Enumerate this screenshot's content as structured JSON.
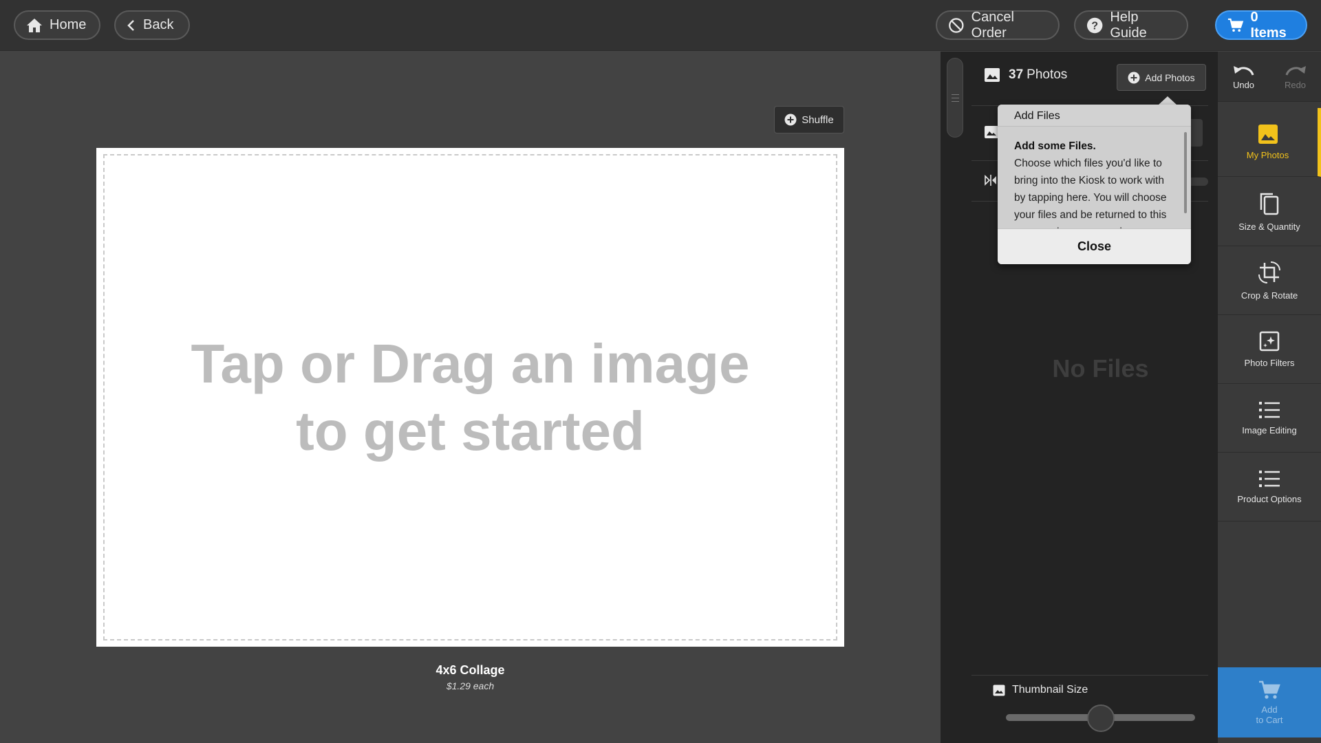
{
  "topbar": {
    "home_label": "Home",
    "back_label": "Back",
    "cancel_label": "Cancel Order",
    "help_label": "Help Guide",
    "cart_label": "0 Items"
  },
  "canvas": {
    "shuffle_label": "Shuffle",
    "drop_line1": "Tap or Drag an image",
    "drop_line2": "to get started",
    "product_name": "4x6 Collage",
    "product_price": "$1.29 each"
  },
  "photos_panel": {
    "count": "37",
    "count_label": "Photos",
    "add_photos_label": "Add Photos",
    "empty_label": "No Files",
    "thumbnail_label": "Thumbnail Size",
    "thumbnail_size_fraction": 0.5
  },
  "popover": {
    "title": "Add Files",
    "lead": "Add some Files.",
    "body": "Choose which files you'd like to bring into the Kiosk to work with by tapping here. You will choose your files and be returned to this screen when you are done.",
    "close_label": "Close"
  },
  "rail": {
    "undo_label": "Undo",
    "redo_label": "Redo",
    "tools": [
      {
        "label": "My Photos",
        "icon": "image-icon",
        "active": true
      },
      {
        "label": "Size & Quantity",
        "icon": "copy-icon",
        "active": false
      },
      {
        "label": "Crop & Rotate",
        "icon": "crop-rotate-icon",
        "active": false
      },
      {
        "label": "Photo Filters",
        "icon": "filter-icon",
        "active": false
      },
      {
        "label": "Image Editing",
        "icon": "sliders-icon",
        "active": false
      },
      {
        "label": "Product Options",
        "icon": "sliders-icon",
        "active": false
      }
    ],
    "add_to_cart_line1": "Add",
    "add_to_cart_line2": "to Cart"
  },
  "colors": {
    "accent": "#f2c21b",
    "cart_blue": "#1f7fe0",
    "add_to_cart_blue": "#2e7fc9"
  }
}
